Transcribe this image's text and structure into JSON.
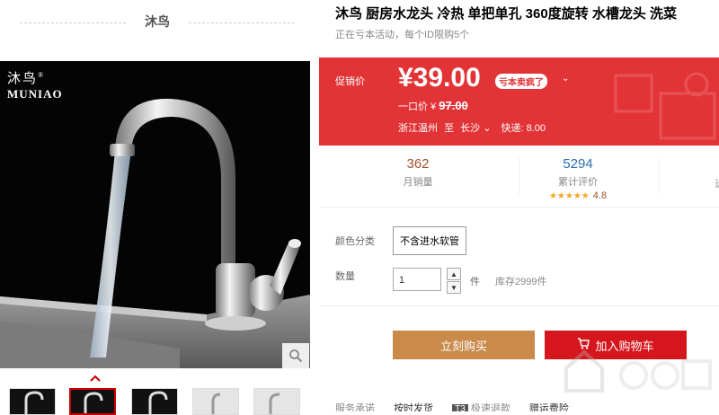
{
  "brand": {
    "name": "沐鸟"
  },
  "logo": {
    "cn": "沐鸟",
    "en": "MUNIAO",
    "reg": "®"
  },
  "product": {
    "title": "沐鸟 厨房水龙头 冷热 单把单孔 360度旋转 水槽龙头 洗菜",
    "subtitle": "正在亏本活动，每个ID限购5个"
  },
  "price": {
    "label": "促销价",
    "value": "¥39.00",
    "badge": "亏本卖疯了",
    "badge_caret": "⌄",
    "orig_label": "一口价 ¥",
    "orig_value": "97.00",
    "ship_from": "浙江温州",
    "ship_to_word": "至",
    "ship_to": "长沙",
    "ship_caret": "⌄",
    "delivery": "快递: 8.00"
  },
  "stats": {
    "sales_num": "362",
    "sales_label": "月销量",
    "reviews_num": "5294",
    "reviews_label": "累计评价",
    "stars": "★★★★★",
    "score": "4.8",
    "third_label": "送"
  },
  "options": {
    "color_label": "颜色分类",
    "color_value": "不含进水软管",
    "qty_label": "数量",
    "qty_value": "1",
    "qty_up": "▲",
    "qty_down": "▼",
    "unit": "件",
    "stock": "库存2999件"
  },
  "actions": {
    "buy_label": "立刻购买",
    "cart_label": "加入购物车"
  },
  "promise": {
    "label": "服务承诺",
    "item1": "按时发货",
    "t3": "T3",
    "item2": "极速退款",
    "item3": "赠运费险"
  },
  "icons": {
    "zoom": "search-icon",
    "cart": "cart-icon",
    "prev": "chevron-up-icon"
  },
  "colors": {
    "price_bg": "#e23437",
    "buy": "#c98a4a",
    "cart": "#d6161d",
    "accent": "#2f6eaf"
  }
}
